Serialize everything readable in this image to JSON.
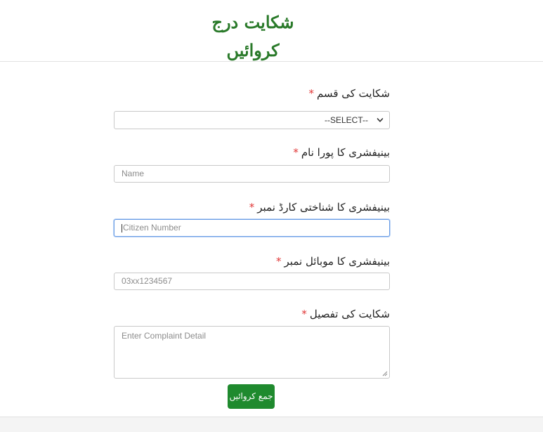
{
  "header": {
    "title": "شکایت درج کروائیں"
  },
  "form": {
    "required_mark": "*",
    "complaint_type": {
      "label": "شکایت کی قسم",
      "selected": "--SELECT--"
    },
    "full_name": {
      "label": "بینیفشری کا پورا نام",
      "placeholder": "Name"
    },
    "cnic": {
      "label": "بینیفشری کا شناختی کارڈ نمبر",
      "placeholder": "Citizen Number"
    },
    "mobile": {
      "label": "بینیفشری کا موبائل نمبر",
      "placeholder": "03xx1234567"
    },
    "detail": {
      "label": "شکایت کی تفصیل",
      "placeholder": "Enter Complaint Detail"
    },
    "submit_label": "جمع کروائیں"
  },
  "icons": {
    "select_arrow": "chevron-down-icon",
    "textarea_resize": "resize-handle-icon"
  },
  "colors": {
    "title": "#2a7a2a",
    "submit_bg": "#1f8a2e",
    "required": "#e03535",
    "focus_border": "#6d9fe6"
  }
}
